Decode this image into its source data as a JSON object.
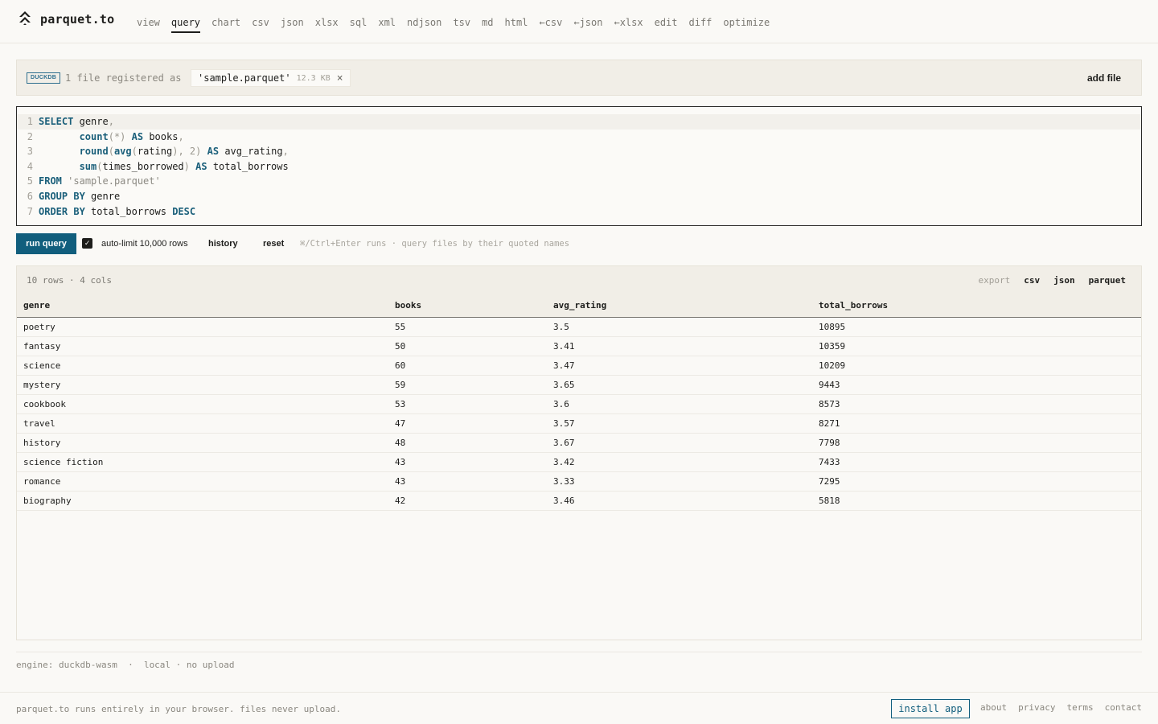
{
  "app": {
    "name": "parquet.to",
    "logo_icon": "double-chevron-up-icon"
  },
  "nav": {
    "items": [
      "view",
      "query",
      "chart",
      "csv",
      "json",
      "xlsx",
      "sql",
      "xml",
      "ndjson",
      "tsv",
      "md",
      "html",
      "←csv",
      "←json",
      "←xlsx",
      "edit",
      "diff",
      "optimize"
    ],
    "active": "query"
  },
  "filebar": {
    "badge": "DUCKDB",
    "registered_text": "1 file registered as",
    "file_name": "'sample.parquet'",
    "file_size": "12.3 KB",
    "close_glyph": "×",
    "add_file_label": "add file"
  },
  "editor": {
    "line_numbers": [
      "1",
      "2",
      "3",
      "4",
      "5",
      "6",
      "7"
    ],
    "lines": [
      "SELECT genre,",
      "       count(*) AS books,",
      "       round(avg(rating), 2) AS avg_rating,",
      "       sum(times_borrowed) AS total_borrows",
      "FROM 'sample.parquet'",
      "GROUP BY genre",
      "ORDER BY total_borrows DESC"
    ]
  },
  "toolbar": {
    "run_label": "run query",
    "autolimit_checked": true,
    "autolimit_label": "auto-limit 10,000 rows",
    "history_label": "history",
    "reset_label": "reset",
    "hint": "⌘/Ctrl+Enter runs · query files by their quoted names"
  },
  "results": {
    "summary": "10 rows · 4 cols",
    "export_label": "export",
    "export_formats": [
      "csv",
      "json",
      "parquet"
    ],
    "columns": [
      "genre",
      "books",
      "avg_rating",
      "total_borrows"
    ],
    "rows": [
      [
        "poetry",
        "55",
        "3.5",
        "10895"
      ],
      [
        "fantasy",
        "50",
        "3.41",
        "10359"
      ],
      [
        "science",
        "60",
        "3.47",
        "10209"
      ],
      [
        "mystery",
        "59",
        "3.65",
        "9443"
      ],
      [
        "cookbook",
        "53",
        "3.6",
        "8573"
      ],
      [
        "travel",
        "47",
        "3.57",
        "8271"
      ],
      [
        "history",
        "48",
        "3.67",
        "7798"
      ],
      [
        "science fiction",
        "43",
        "3.42",
        "7433"
      ],
      [
        "romance",
        "43",
        "3.33",
        "7295"
      ],
      [
        "biography",
        "42",
        "3.46",
        "5818"
      ]
    ]
  },
  "engine": {
    "text": "engine: duckdb-wasm  ·  local · no upload"
  },
  "footer": {
    "note": "parquet.to runs entirely in your browser. files never upload.",
    "install_label": "install app",
    "links": [
      "about",
      "privacy",
      "terms",
      "contact"
    ]
  },
  "colors": {
    "accent": "#115e7d",
    "background": "#faf9f6",
    "panel": "#f1eee7",
    "keyword": "#1a5f7a"
  }
}
